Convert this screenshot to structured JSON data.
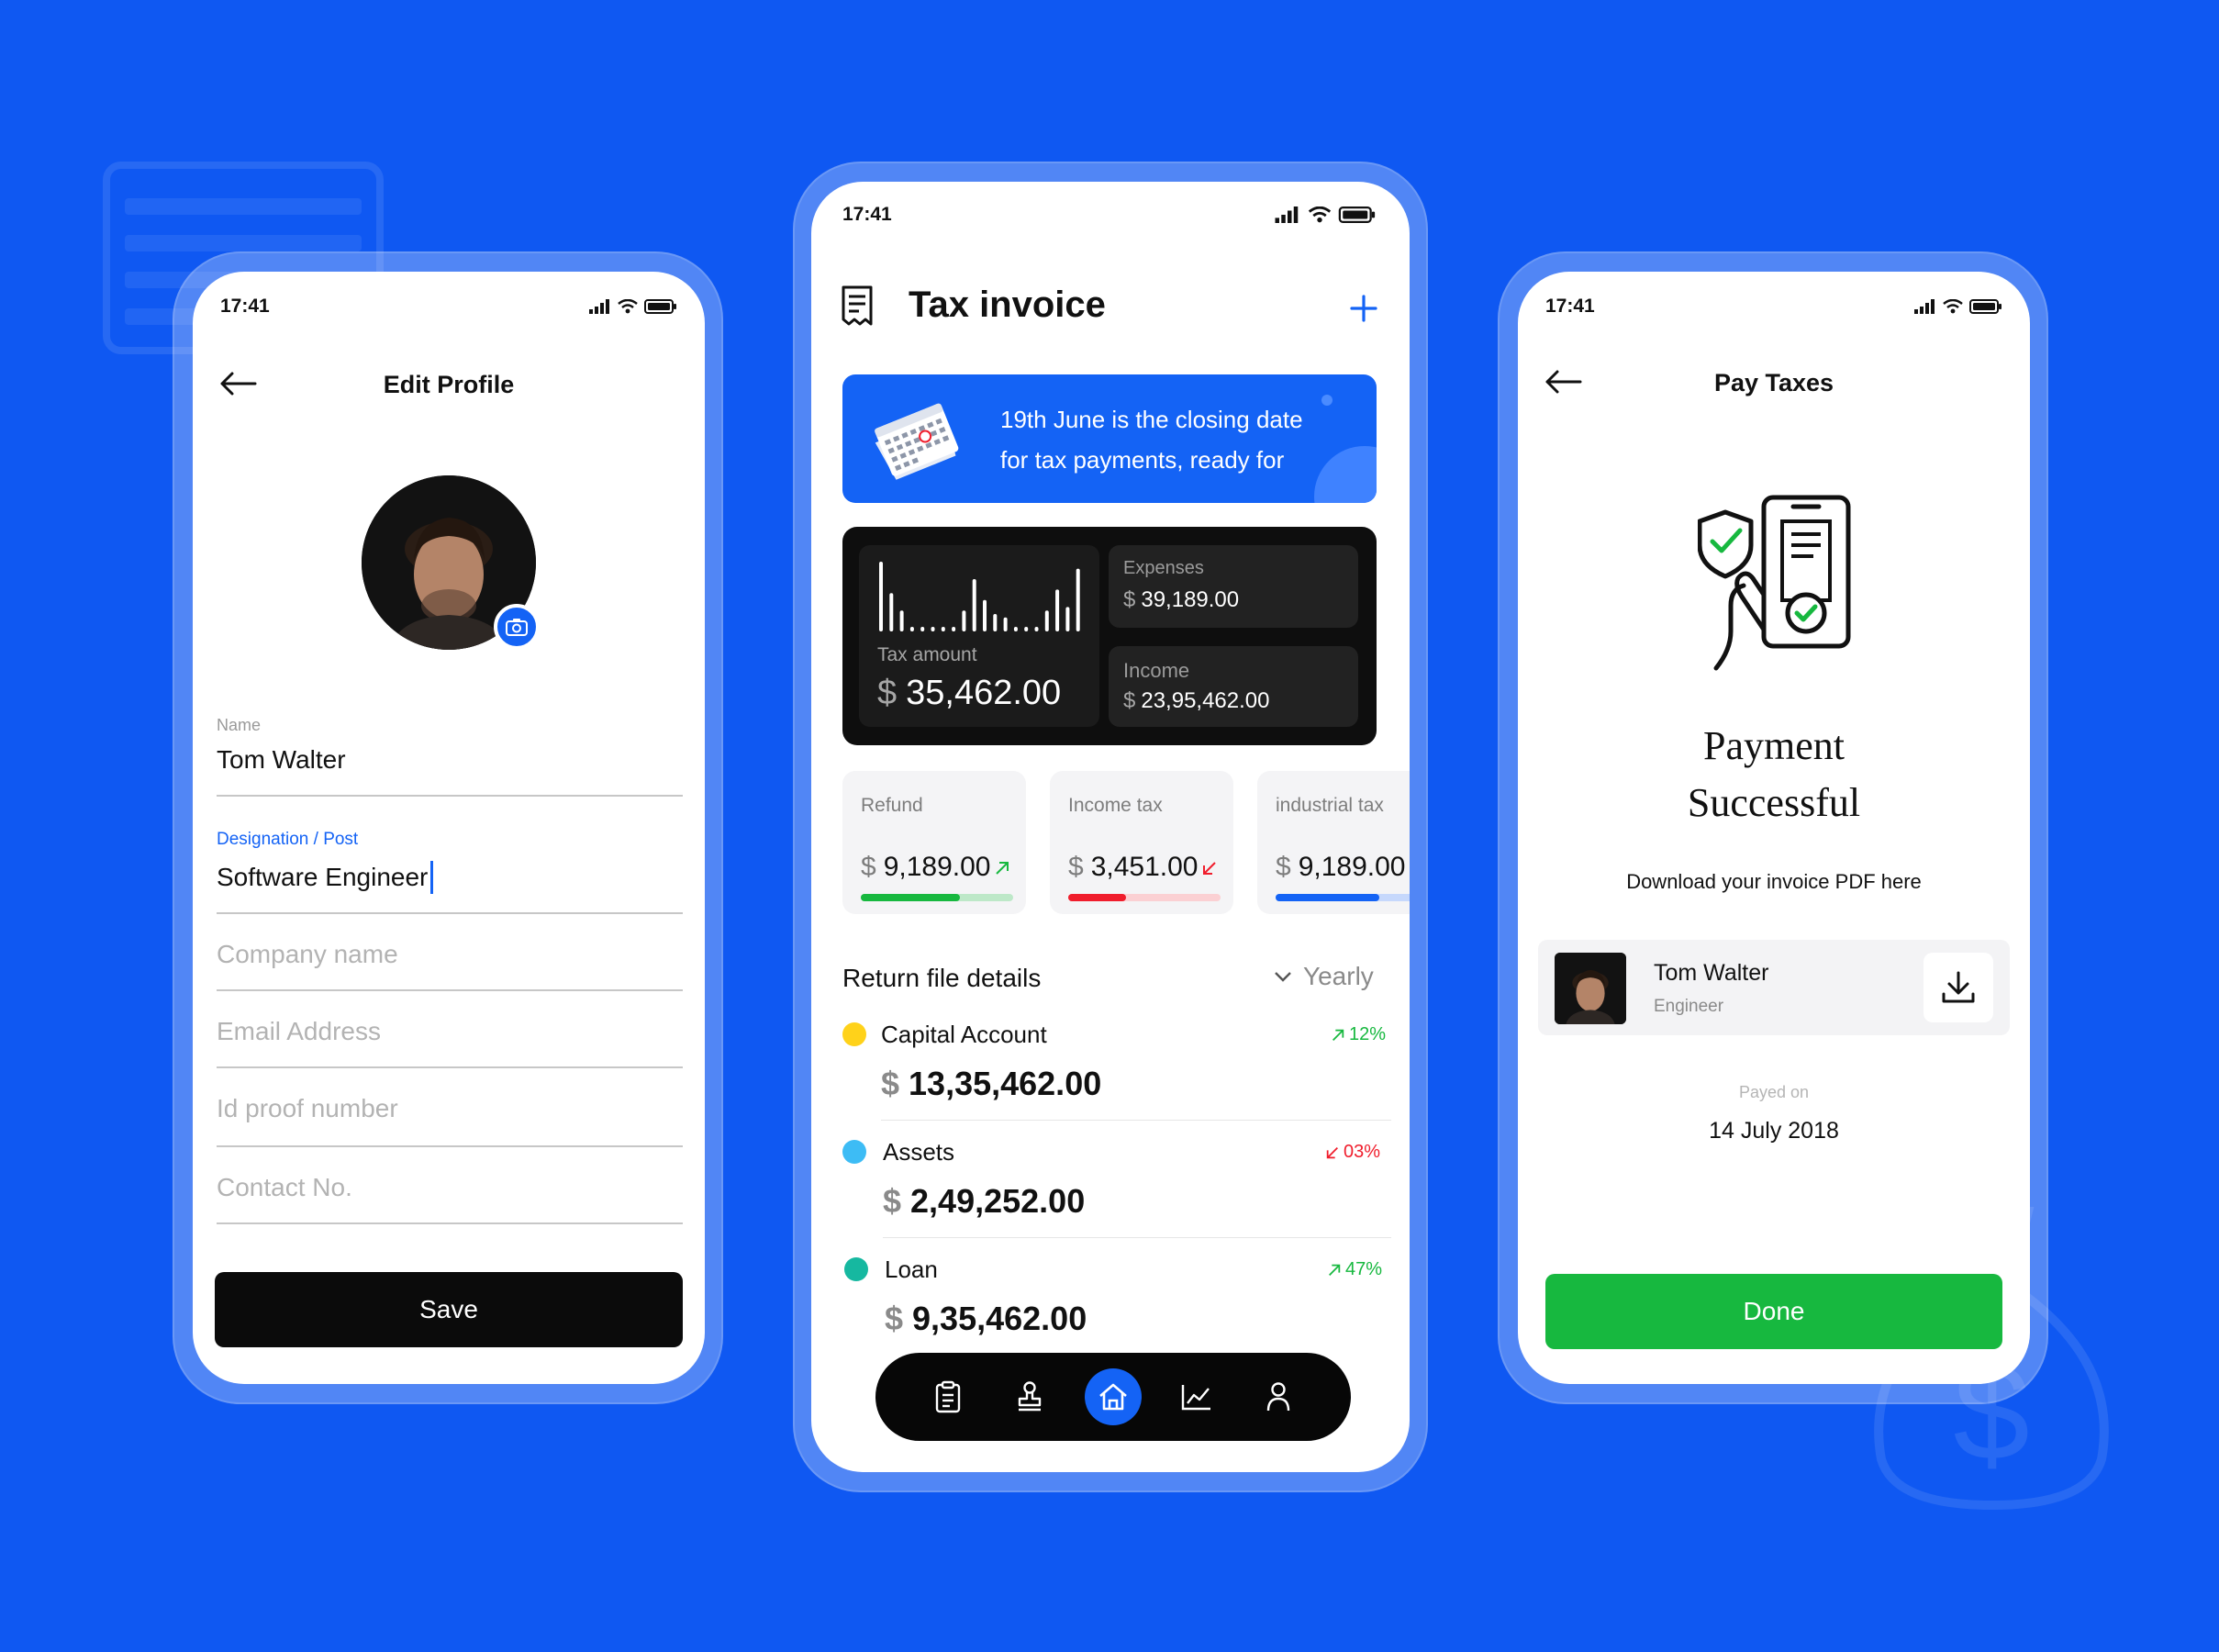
{
  "status": {
    "time": "17:41"
  },
  "edit_profile": {
    "title": "Edit Profile",
    "name_label": "Name",
    "name_value": "Tom Walter",
    "designation_label_a": "Designation",
    "designation_label_sep": " / ",
    "designation_label_b": "Post",
    "designation_value": "Software Engineer",
    "company_placeholder": "Company name",
    "email_placeholder": "Email Address",
    "idproof_placeholder": "Id proof number",
    "contact_placeholder": "Contact No.",
    "save_label": "Save"
  },
  "tax_invoice": {
    "title": "Tax invoice",
    "banner_line1": "19th June is the closing date",
    "banner_line2": "for tax payments, ready for",
    "tax_amount_label": "Tax amount",
    "currency": "$",
    "tax_amount_value": "35,462.00",
    "expenses_label": "Expenses",
    "expenses_value": "39,189.00",
    "income_label": "Income",
    "income_value": "23,95,462.00",
    "stats": [
      {
        "label": "Refund",
        "value": "9,189.00",
        "progress": 0.65,
        "color": "#17b83f",
        "track": "#bde8c8",
        "trend": "up"
      },
      {
        "label": "Income tax",
        "value": "3,451.00",
        "progress": 0.38,
        "color": "#f01d2c",
        "track": "#fbd0d3",
        "trend": "down"
      },
      {
        "label": "industrial tax",
        "value": "9,189.00",
        "progress": 0.68,
        "color": "#1463f5",
        "track": "#c6d8fc",
        "trend": "up"
      }
    ],
    "section_title": "Return file details",
    "filter_label": "Yearly",
    "rows": [
      {
        "name": "Capital Account",
        "amount": "13,35,462.00",
        "pct": "12%",
        "trend": "up",
        "dot": "#ffd21a"
      },
      {
        "name": "Assets",
        "amount": "2,49,252.00",
        "pct": "03%",
        "trend": "down",
        "dot": "#3dbcf5"
      },
      {
        "name": "Loan",
        "amount": "9,35,462.00",
        "pct": "47%",
        "trend": "up",
        "dot": "#16b8a0"
      }
    ]
  },
  "pay_taxes": {
    "title": "Pay Taxes",
    "success_line1": "Payment",
    "success_line2": "Successful",
    "download_text": "Download your invoice PDF here",
    "user_name": "Tom Walter",
    "user_role": "Engineer",
    "payed_on_label": "Payed on",
    "payed_on_value": "14 July 2018",
    "done_label": "Done"
  },
  "colors": {
    "background": "#0f58f2",
    "accent": "#1463f5",
    "success": "#17b83f",
    "danger": "#f01d2c"
  }
}
